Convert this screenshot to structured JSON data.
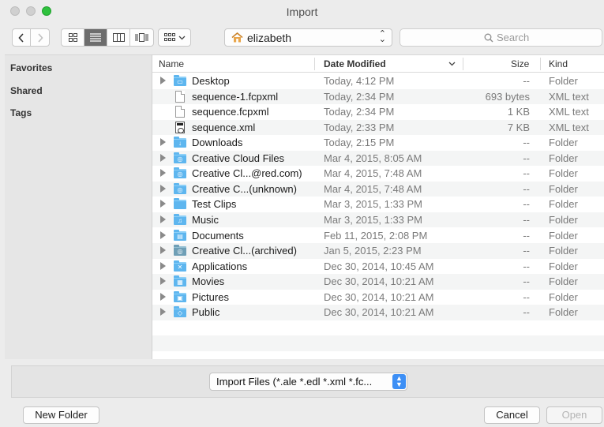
{
  "window": {
    "title": "Import"
  },
  "toolbar": {
    "back_label": "‹",
    "forward_label": "›",
    "location": "elizabeth",
    "search_placeholder": "Search"
  },
  "sidebar": {
    "sections": [
      "Favorites",
      "Shared",
      "Tags"
    ]
  },
  "columns": {
    "name": "Name",
    "date": "Date Modified",
    "size": "Size",
    "kind": "Kind"
  },
  "files": [
    {
      "name": "Desktop",
      "date": "Today, 4:12 PM",
      "size": "--",
      "kind": "Folder",
      "icon": "folder-desktop-icon"
    },
    {
      "name": "sequence-1.fcpxml",
      "date": "Today, 2:34 PM",
      "size": "693 bytes",
      "kind": "XML text",
      "icon": "document-icon"
    },
    {
      "name": "sequence.fcpxml",
      "date": "Today, 2:34 PM",
      "size": "1 KB",
      "kind": "XML text",
      "icon": "document-icon"
    },
    {
      "name": "sequence.xml",
      "date": "Today, 2:33 PM",
      "size": "7 KB",
      "kind": "XML text",
      "icon": "xml-document-icon"
    },
    {
      "name": "Downloads",
      "date": "Today, 2:15 PM",
      "size": "--",
      "kind": "Folder",
      "icon": "folder-downloads-icon"
    },
    {
      "name": "Creative Cloud Files",
      "date": "Mar 4, 2015, 8:05 AM",
      "size": "--",
      "kind": "Folder",
      "icon": "folder-creative-cloud-icon"
    },
    {
      "name": "Creative Cl...@red.com)",
      "date": "Mar 4, 2015, 7:48 AM",
      "size": "--",
      "kind": "Folder",
      "icon": "folder-creative-cloud-icon"
    },
    {
      "name": "Creative C...(unknown)",
      "date": "Mar 4, 2015, 7:48 AM",
      "size": "--",
      "kind": "Folder",
      "icon": "folder-creative-cloud-icon"
    },
    {
      "name": "Test Clips",
      "date": "Mar 3, 2015, 1:33 PM",
      "size": "--",
      "kind": "Folder",
      "icon": "folder-icon"
    },
    {
      "name": "Music",
      "date": "Mar 3, 2015, 1:33 PM",
      "size": "--",
      "kind": "Folder",
      "icon": "folder-music-icon"
    },
    {
      "name": "Documents",
      "date": "Feb 11, 2015, 2:08 PM",
      "size": "--",
      "kind": "Folder",
      "icon": "folder-documents-icon"
    },
    {
      "name": "Creative Cl...(archived)",
      "date": "Jan 5, 2015, 2:23 PM",
      "size": "--",
      "kind": "Folder",
      "icon": "folder-archived-icon"
    },
    {
      "name": "Applications",
      "date": "Dec 30, 2014, 10:45 AM",
      "size": "--",
      "kind": "Folder",
      "icon": "folder-applications-icon"
    },
    {
      "name": "Movies",
      "date": "Dec 30, 2014, 10:21 AM",
      "size": "--",
      "kind": "Folder",
      "icon": "folder-movies-icon"
    },
    {
      "name": "Pictures",
      "date": "Dec 30, 2014, 10:21 AM",
      "size": "--",
      "kind": "Folder",
      "icon": "folder-pictures-icon"
    },
    {
      "name": "Public",
      "date": "Dec 30, 2014, 10:21 AM",
      "size": "--",
      "kind": "Folder",
      "icon": "folder-public-icon"
    }
  ],
  "filter": {
    "selected": "Import Files (*.ale *.edl *.xml *.fc..."
  },
  "buttons": {
    "new_folder": "New Folder",
    "cancel": "Cancel",
    "open": "Open"
  },
  "colors": {
    "accent": "#3d8ff5",
    "folder": "#5eb6ef",
    "maximize": "#2fc13e"
  }
}
